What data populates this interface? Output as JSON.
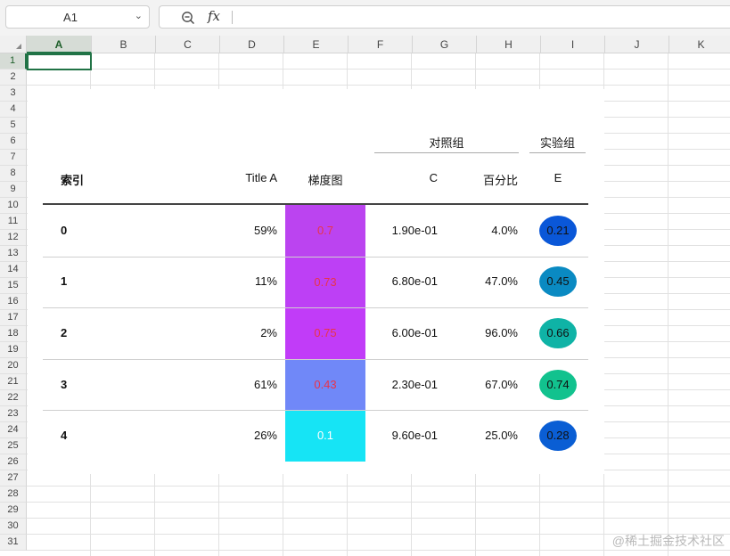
{
  "formula_bar": {
    "name_box": "A1",
    "fx_label": "fx",
    "formula": ""
  },
  "columns": [
    "A",
    "B",
    "C",
    "D",
    "E",
    "F",
    "G",
    "H",
    "I",
    "J",
    "K"
  ],
  "rows": [
    "1",
    "2",
    "3",
    "4",
    "5",
    "6",
    "7",
    "8",
    "9",
    "10",
    "11",
    "12",
    "13",
    "14",
    "15",
    "16",
    "17",
    "18",
    "19",
    "20",
    "21",
    "22",
    "23",
    "24",
    "25",
    "26",
    "27",
    "28",
    "29",
    "30",
    "31"
  ],
  "table": {
    "spanners": [
      "对照组",
      "实验组"
    ],
    "headers": {
      "index": "索引",
      "title_a": "Title A",
      "gradient": "梯度图",
      "c": "C",
      "percent": "百分比",
      "e": "E"
    },
    "rows": [
      {
        "index": "0",
        "title_a": "59%",
        "gradient": "0.7",
        "c": "1.90e-01",
        "percent": "4.0%",
        "e": "0.21",
        "grad_bg": "#bb44f0",
        "grad_fg": "#e8344a",
        "e_bg": "#0a57d8"
      },
      {
        "index": "1",
        "title_a": "11%",
        "gradient": "0.73",
        "c": "6.80e-01",
        "percent": "47.0%",
        "e": "0.45",
        "grad_bg": "#bd40f5",
        "grad_fg": "#e8344a",
        "e_bg": "#0a8ac2"
      },
      {
        "index": "2",
        "title_a": "2%",
        "gradient": "0.75",
        "c": "6.00e-01",
        "percent": "96.0%",
        "e": "0.66",
        "grad_bg": "#c13cf8",
        "grad_fg": "#e8344a",
        "e_bg": "#0fb3a6"
      },
      {
        "index": "3",
        "title_a": "61%",
        "gradient": "0.43",
        "c": "2.30e-01",
        "percent": "67.0%",
        "e": "0.74",
        "grad_bg": "#7088f8",
        "grad_fg": "#e8344a",
        "e_bg": "#12c28e"
      },
      {
        "index": "4",
        "title_a": "26%",
        "gradient": "0.1",
        "c": "9.60e-01",
        "percent": "25.0%",
        "e": "0.28",
        "grad_bg": "#16e4f5",
        "grad_fg": "#ffffff",
        "e_bg": "#0a5ed4"
      }
    ]
  },
  "watermark": "@稀土掘金技术社区"
}
